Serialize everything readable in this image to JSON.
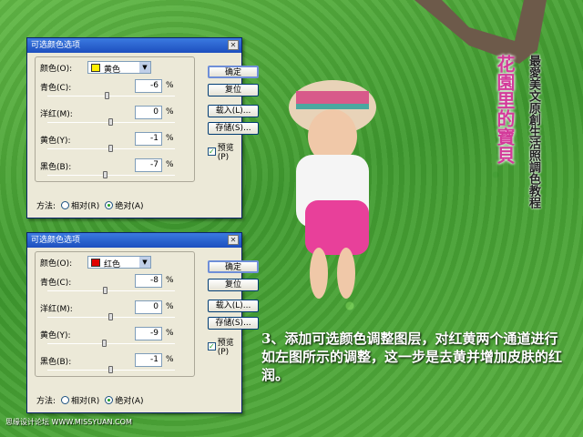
{
  "dialogs": [
    {
      "title": "可选颜色选项",
      "color_label": "颜色(O):",
      "color_value": "黄色",
      "swatch": "#ffef00",
      "channels": [
        {
          "label": "青色(C):",
          "value": "-6",
          "pct": 0.47
        },
        {
          "label": "洋红(M):",
          "value": "0",
          "pct": 0.5
        },
        {
          "label": "黄色(Y):",
          "value": "-1",
          "pct": 0.5
        },
        {
          "label": "黑色(B):",
          "value": "-7",
          "pct": 0.46
        }
      ],
      "buttons": {
        "ok": "确定",
        "reset": "复位",
        "load": "载入(L)...",
        "save": "存储(S)...",
        "preview": "预览(P)"
      },
      "method_label": "方法:",
      "relative": "相对(R)",
      "absolute": "绝对(A)"
    },
    {
      "title": "可选颜色选项",
      "color_label": "颜色(O):",
      "color_value": "红色",
      "swatch": "#e00000",
      "channels": [
        {
          "label": "青色(C):",
          "value": "-8",
          "pct": 0.46
        },
        {
          "label": "洋红(M):",
          "value": "0",
          "pct": 0.5
        },
        {
          "label": "黄色(Y):",
          "value": "-9",
          "pct": 0.45
        },
        {
          "label": "黑色(B):",
          "value": "-1",
          "pct": 0.5
        }
      ],
      "buttons": {
        "ok": "确定",
        "reset": "复位",
        "load": "载入(L)...",
        "save": "存储(S)...",
        "preview": "预览(P)"
      },
      "method_label": "方法:",
      "relative": "相对(R)",
      "absolute": "绝对(A)"
    }
  ],
  "side_title": "花園里的寶貝",
  "side_subtitle": "最愛美文原創生活照調色教程",
  "caption": "3、添加可选颜色调整图层，对红黄两个通道进行如左图所示的调整，这一步是去黄并增加皮肤的红润。",
  "watermark": "思缘设计论坛 WWW.MISSYUAN.COM"
}
